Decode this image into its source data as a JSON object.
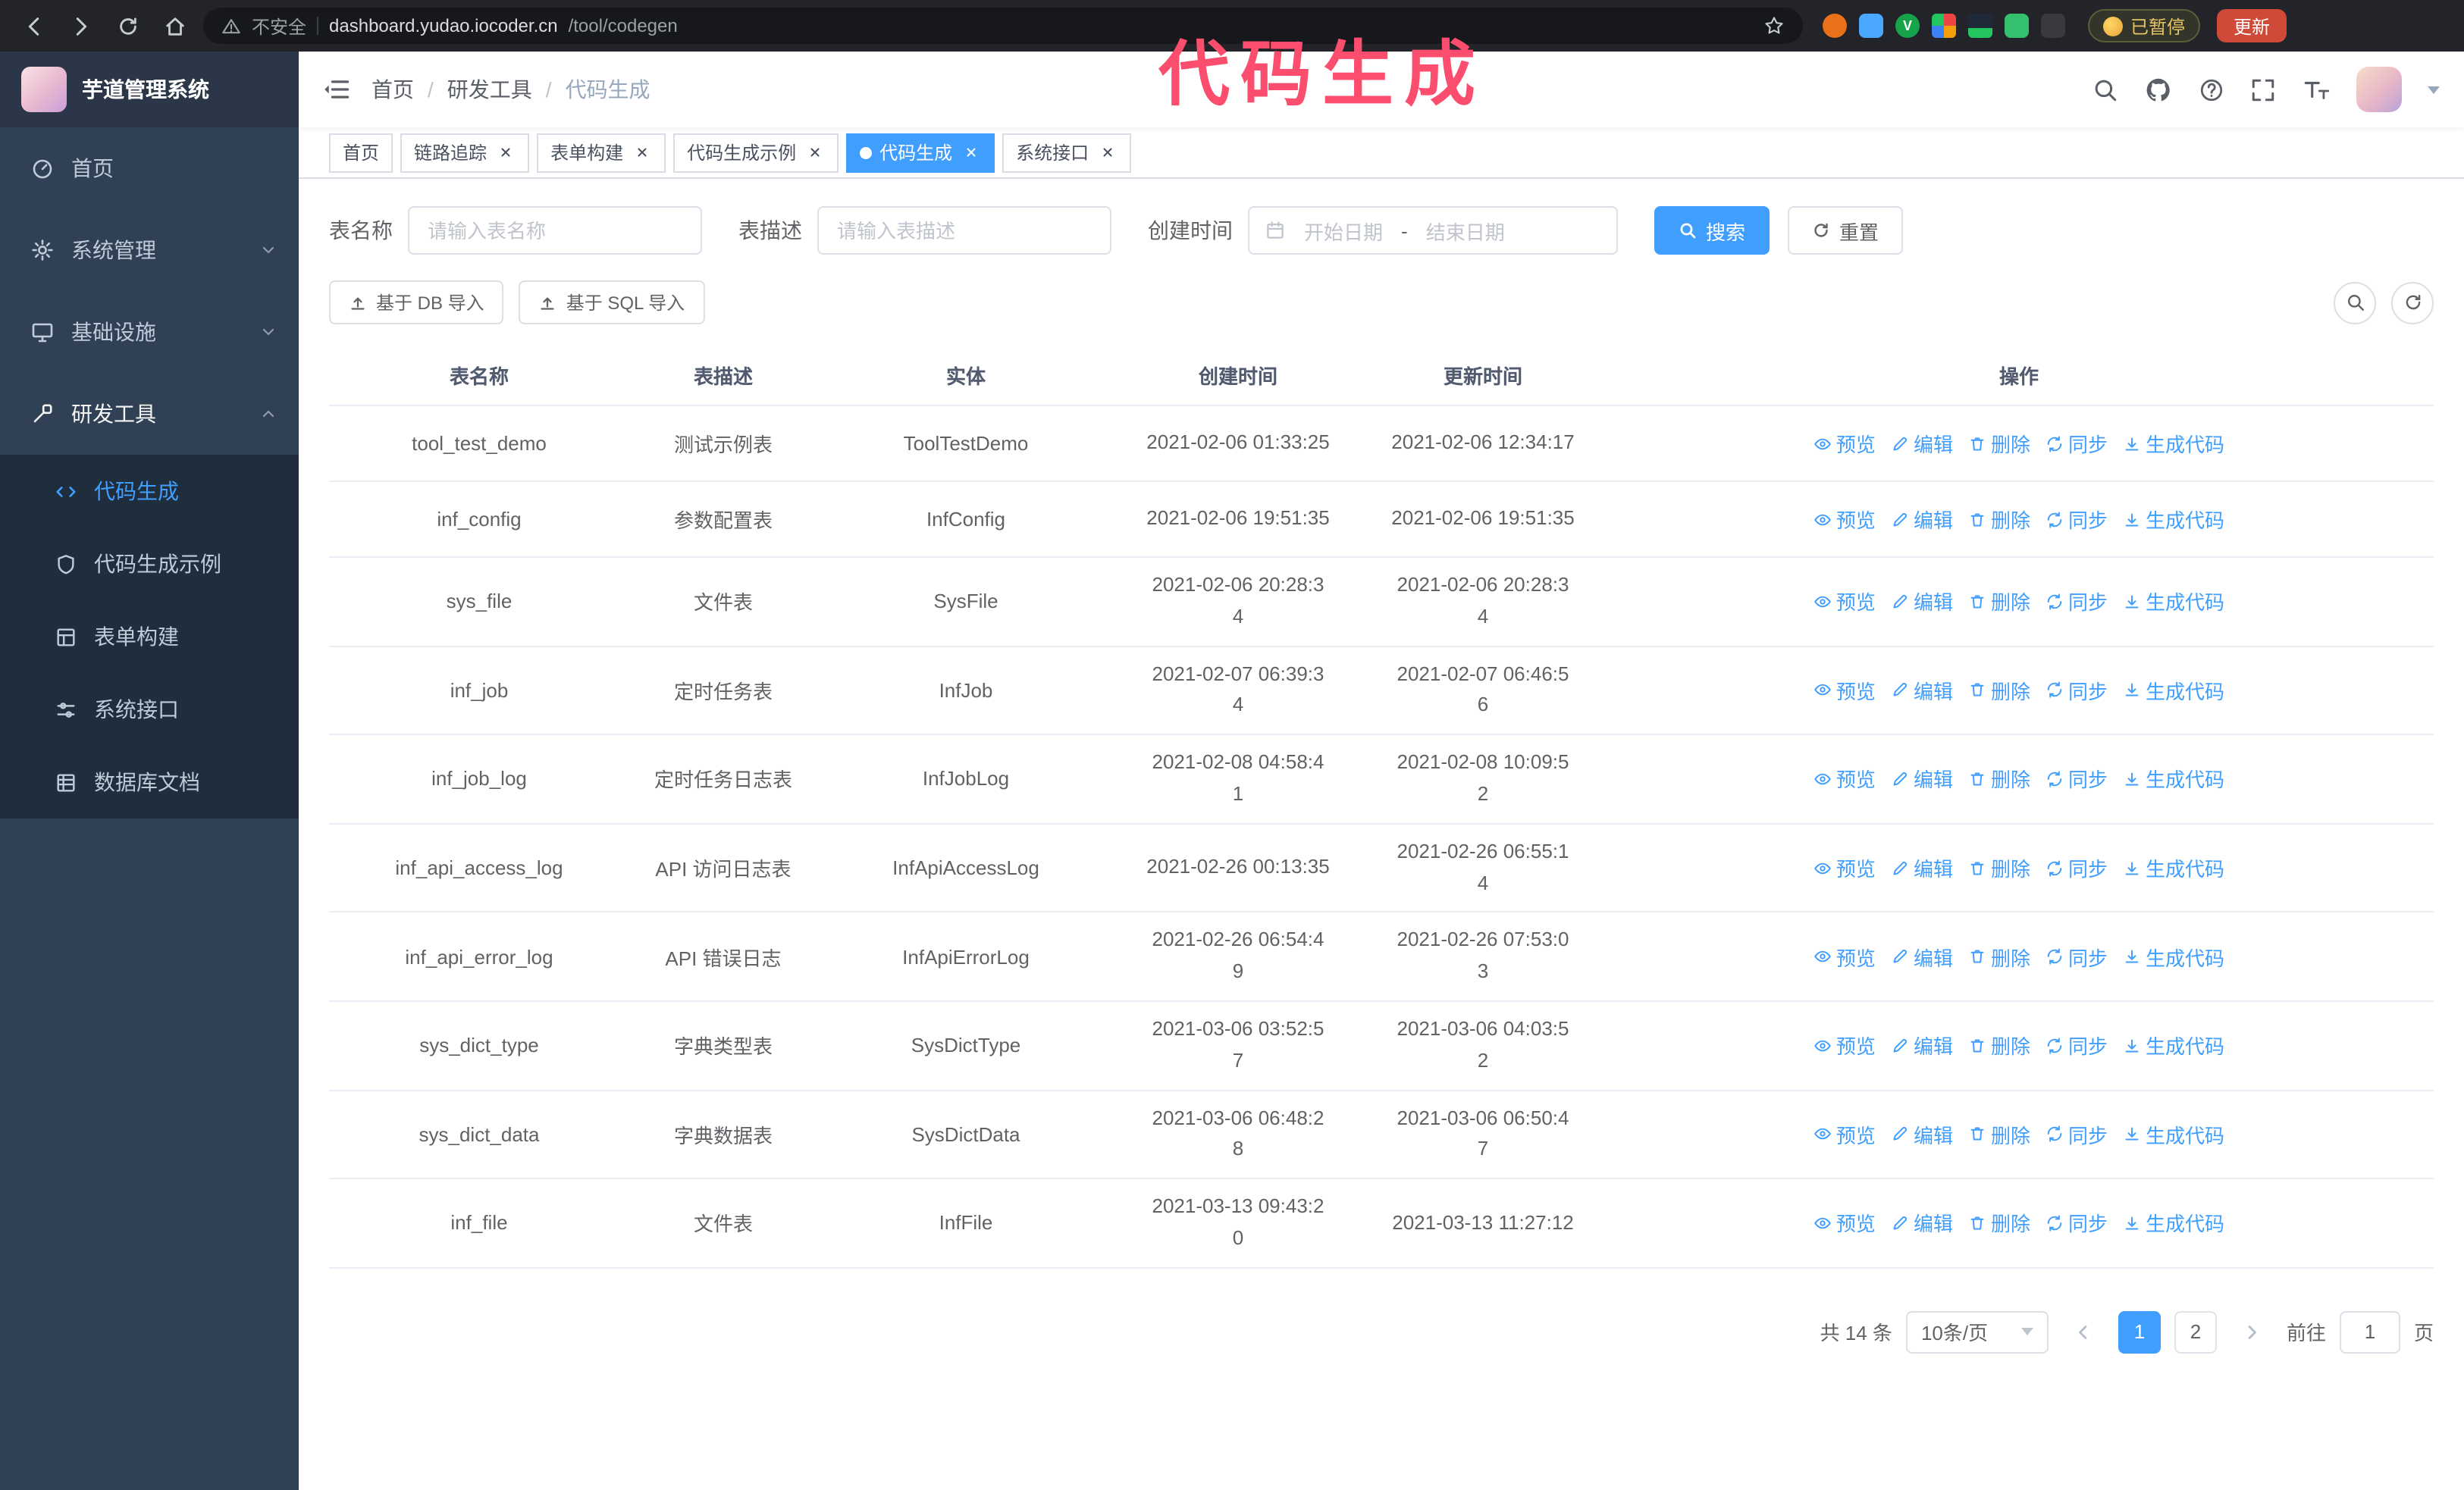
{
  "colors": {
    "accent": "#409eff",
    "sidebar_bg": "#304156",
    "submenu_bg": "#1f2d3d",
    "annotation": "#fb4d6d",
    "active_tab_bg": "#409eff"
  },
  "browser": {
    "security_label": "不安全",
    "url_domain": "dashboard.yudao.iocoder.cn",
    "url_path": "/tool/codegen",
    "ext_badge": "V",
    "paused_badge": "已暂停",
    "update_button": "更新"
  },
  "annotation": {
    "text": "代码生成"
  },
  "sidebar": {
    "logo_title": "芋道管理系统",
    "items": [
      {
        "label": "首页"
      },
      {
        "label": "系统管理"
      },
      {
        "label": "基础设施"
      },
      {
        "label": "研发工具"
      }
    ],
    "subitems": [
      {
        "label": "代码生成"
      },
      {
        "label": "代码生成示例"
      },
      {
        "label": "表单构建"
      },
      {
        "label": "系统接口"
      },
      {
        "label": "数据库文档"
      }
    ]
  },
  "header": {
    "breadcrumb": [
      "首页",
      "研发工具",
      "代码生成"
    ],
    "breadcrumb_separator": "/"
  },
  "tabs": [
    {
      "label": "首页"
    },
    {
      "label": "链路追踪"
    },
    {
      "label": "表单构建"
    },
    {
      "label": "代码生成示例"
    },
    {
      "label": "代码生成"
    },
    {
      "label": "系统接口"
    }
  ],
  "filters": {
    "table_name_label": "表名称",
    "table_name_placeholder": "请输入表名称",
    "table_desc_label": "表描述",
    "table_desc_placeholder": "请输入表描述",
    "create_time_label": "创建时间",
    "date_start_placeholder": "开始日期",
    "date_separator": "-",
    "date_end_placeholder": "结束日期",
    "search_button": "搜索",
    "reset_button": "重置"
  },
  "toolbar": {
    "import_db": "基于 DB 导入",
    "import_sql": "基于 SQL 导入"
  },
  "table": {
    "columns": [
      "表名称",
      "表描述",
      "实体",
      "创建时间",
      "更新时间",
      "操作"
    ],
    "actions": [
      "预览",
      "编辑",
      "删除",
      "同步",
      "生成代码"
    ],
    "rows": [
      {
        "name": "tool_test_demo",
        "desc": "测试示例表",
        "entity": "ToolTestDemo",
        "created": "2021-02-06 01:33:25",
        "updated": "2021-02-06 12:34:17"
      },
      {
        "name": "inf_config",
        "desc": "参数配置表",
        "entity": "InfConfig",
        "created": "2021-02-06 19:51:35",
        "updated": "2021-02-06 19:51:35"
      },
      {
        "name": "sys_file",
        "desc": "文件表",
        "entity": "SysFile",
        "created": "2021-02-06 20:28:3\n4",
        "updated": "2021-02-06 20:28:3\n4"
      },
      {
        "name": "inf_job",
        "desc": "定时任务表",
        "entity": "InfJob",
        "created": "2021-02-07 06:39:3\n4",
        "updated": "2021-02-07 06:46:5\n6"
      },
      {
        "name": "inf_job_log",
        "desc": "定时任务日志表",
        "entity": "InfJobLog",
        "created": "2021-02-08 04:58:4\n1",
        "updated": "2021-02-08 10:09:5\n2"
      },
      {
        "name": "inf_api_access_log",
        "desc": "API 访问日志表",
        "entity": "InfApiAccessLog",
        "created": "2021-02-26 00:13:35",
        "updated": "2021-02-26 06:55:1\n4"
      },
      {
        "name": "inf_api_error_log",
        "desc": "API 错误日志",
        "entity": "InfApiErrorLog",
        "created": "2021-02-26 06:54:4\n9",
        "updated": "2021-02-26 07:53:0\n3"
      },
      {
        "name": "sys_dict_type",
        "desc": "字典类型表",
        "entity": "SysDictType",
        "created": "2021-03-06 03:52:5\n7",
        "updated": "2021-03-06 04:03:5\n2"
      },
      {
        "name": "sys_dict_data",
        "desc": "字典数据表",
        "entity": "SysDictData",
        "created": "2021-03-06 06:48:2\n8",
        "updated": "2021-03-06 06:50:4\n7"
      },
      {
        "name": "inf_file",
        "desc": "文件表",
        "entity": "InfFile",
        "created": "2021-03-13 09:43:2\n0",
        "updated": "2021-03-13 11:27:12"
      }
    ]
  },
  "pagination": {
    "total": "共 14 条",
    "page_size": "10条/页",
    "pages": [
      "1",
      "2"
    ],
    "goto_label": "前往",
    "goto_value": "1",
    "goto_suffix": "页"
  }
}
